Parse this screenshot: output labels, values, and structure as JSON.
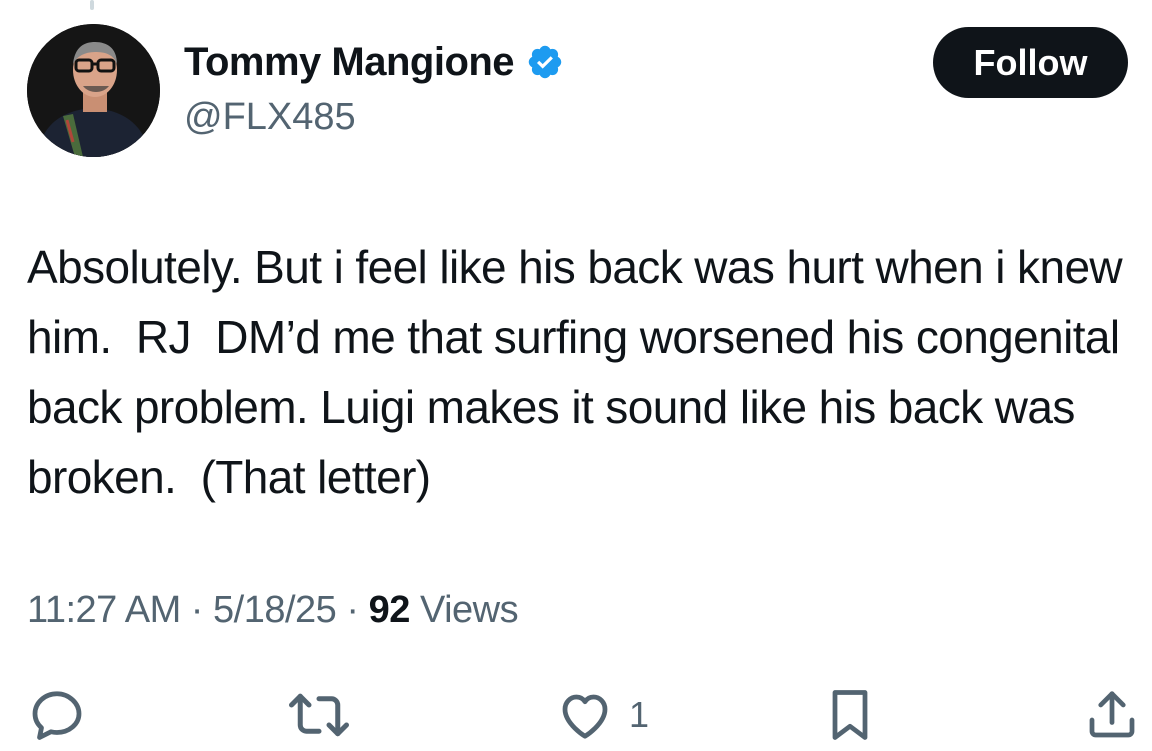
{
  "author": {
    "display_name": "Tommy Mangione",
    "handle": "@FLX485",
    "verified": true
  },
  "follow_button": {
    "label": "Follow"
  },
  "tweet": {
    "text": "Absolutely. But i feel like his back was hurt when i knew him.  RJ  DM’d me that surfing worsened his congenital back problem. Luigi makes it sound like his back was broken.  (That letter)"
  },
  "meta": {
    "time": "11:27 AM",
    "separator": " · ",
    "date": "5/18/25",
    "views_count": "92",
    "views_label": "Views"
  },
  "actions": {
    "reply_icon": "reply-icon",
    "retweet_icon": "retweet-icon",
    "like_icon": "heart-icon",
    "like_count": "1",
    "bookmark_icon": "bookmark-icon",
    "share_icon": "share-icon"
  },
  "colors": {
    "text_primary": "#0f1419",
    "text_secondary": "#536471",
    "verified_blue": "#1d9bf0",
    "button_bg": "#0f1419"
  }
}
